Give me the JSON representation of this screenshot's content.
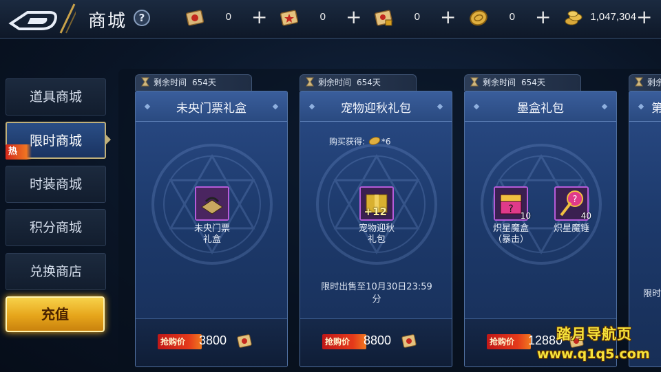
{
  "header": {
    "title": "商城",
    "help_label": "?",
    "resources": [
      {
        "icon": "red-scroll-icon",
        "value": "0",
        "plus": "+"
      },
      {
        "icon": "gold-scroll-icon",
        "value": "0",
        "plus": "+"
      },
      {
        "icon": "locked-scroll-icon",
        "value": "0",
        "plus": "+"
      },
      {
        "icon": "gold-coin-icon",
        "value": "0",
        "plus": "+"
      },
      {
        "icon": "coin-pile-icon",
        "value": "1,047,304",
        "plus": "+"
      }
    ]
  },
  "sidebar": {
    "tabs": [
      {
        "label": "道具商城",
        "active": false
      },
      {
        "label": "限时商城",
        "active": true
      },
      {
        "label": "时装商城",
        "active": false
      },
      {
        "label": "积分商城",
        "active": false
      },
      {
        "label": "兑换商店",
        "active": false
      }
    ],
    "hot_badge": "热",
    "recharge_label": "充值"
  },
  "cards": [
    {
      "timer_label": "剩余时间",
      "timer_days": "654天",
      "title": "未央门票礼盒",
      "items": [
        {
          "name_line1": "未央门票",
          "name_line2": "礼盒",
          "qty": "",
          "icon": "ticket-box-icon"
        }
      ],
      "price_tag": "抢购价",
      "price": "3800"
    },
    {
      "timer_label": "剩余时间",
      "timer_days": "654天",
      "title": "宠物迎秋礼包",
      "bonus_label": "购买获得:",
      "bonus_value": "*6",
      "items": [
        {
          "name_line1": "宠物迎秋",
          "name_line2": "礼包",
          "qty": "+12",
          "icon": "gift-pack-icon"
        }
      ],
      "note_line1": "限时出售至10月30日23:59",
      "note_line2": "分",
      "price_tag": "抢购价",
      "price": "8800"
    },
    {
      "timer_label": "剩余时间",
      "timer_days": "654天",
      "title": "墨盒礼包",
      "items": [
        {
          "name_line1": "炽星魔盒",
          "name_line2": "（暴击）",
          "qty": "10",
          "icon": "mystery-box-icon"
        },
        {
          "name_line1": "炽星魔锤",
          "name_line2": "",
          "qty": "40",
          "icon": "hammer-icon"
        }
      ],
      "price_tag": "抢购价",
      "price": "12880"
    },
    {
      "timer_label": "剩余",
      "title": "第",
      "note_line1": "限时"
    }
  ],
  "watermark": {
    "line1": "踏月导航页",
    "line2": "www.q1q5.com"
  },
  "colors": {
    "accent_gold": "#f0b020",
    "card_blue": "#2a4b86",
    "price_red": "#c01818"
  }
}
